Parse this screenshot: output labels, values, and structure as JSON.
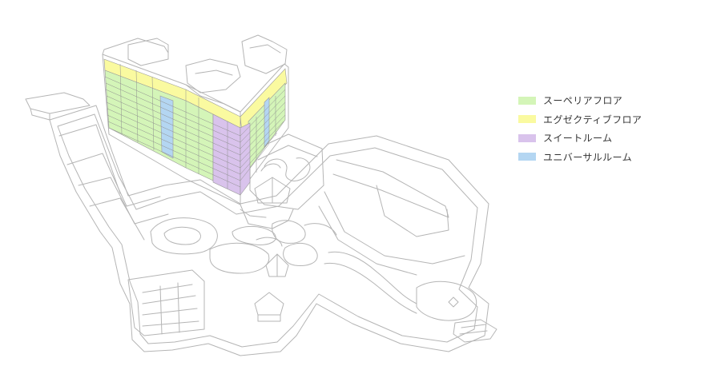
{
  "legend": {
    "items": [
      {
        "key": "superior",
        "label": "スーペリアフロア",
        "color": "#d4f5b8"
      },
      {
        "key": "executive",
        "label": "エグゼクティブフロア",
        "color": "#fafaa0"
      },
      {
        "key": "suite",
        "label": "スイートルーム",
        "color": "#d9c3ec"
      },
      {
        "key": "universal",
        "label": "ユニバーサルルーム",
        "color": "#b4d6f2"
      }
    ]
  },
  "colors": {
    "line": "#b5b5b5",
    "line_dark": "#9a9a9a"
  }
}
